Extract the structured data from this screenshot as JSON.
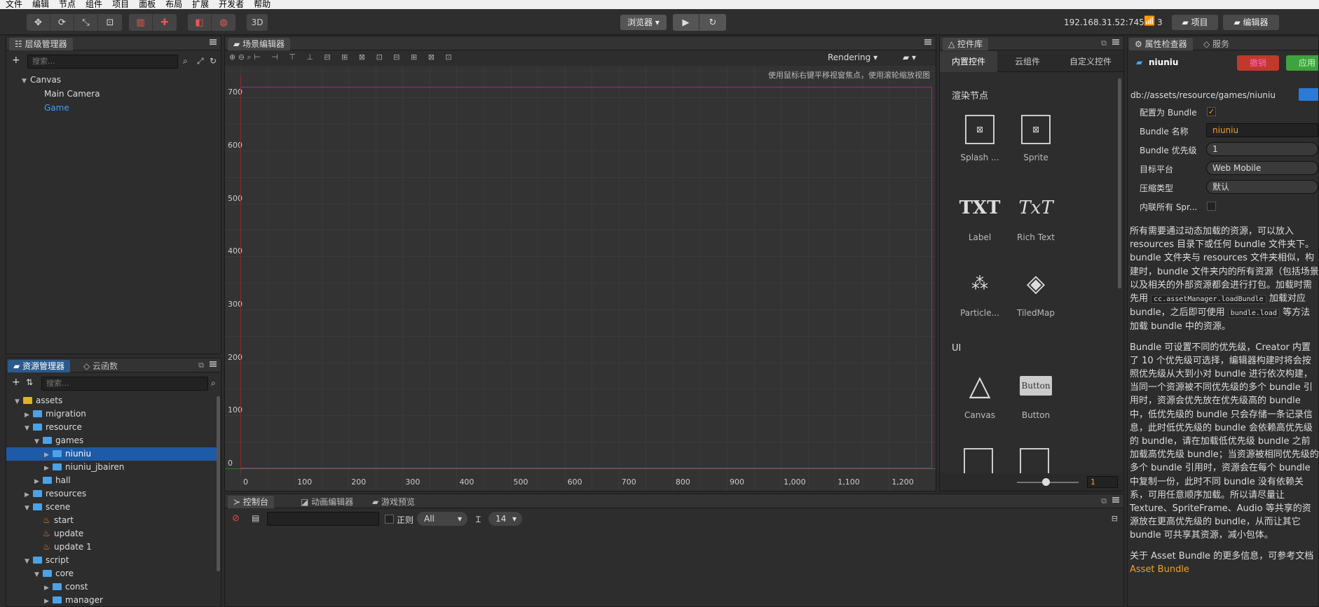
{
  "menu": [
    "文件",
    "编辑",
    "节点",
    "组件",
    "项目",
    "面板",
    "布局",
    "扩展",
    "开发者",
    "帮助"
  ],
  "toolbar": {
    "browser_label": "浏览器 ▾",
    "mode3d": "3D",
    "ip": "192.168.31.52:7456",
    "wifi_count": "3",
    "project_button": "项目",
    "editor_button": "编辑器"
  },
  "hierarchy": {
    "title": "层级管理器",
    "search_placeholder": "搜索...",
    "nodes": [
      "Canvas",
      "Main Camera",
      "Game"
    ]
  },
  "assets": {
    "tab_active": "资源管理器",
    "tab_other": "云函数",
    "search_placeholder": "搜索...",
    "items": [
      {
        "label": "assets",
        "depth": 0,
        "type": "root"
      },
      {
        "label": "migration",
        "depth": 1,
        "type": "folder"
      },
      {
        "label": "resource",
        "depth": 1,
        "type": "folder"
      },
      {
        "label": "games",
        "depth": 2,
        "type": "folder"
      },
      {
        "label": "niuniu",
        "depth": 3,
        "type": "folder",
        "selected": true
      },
      {
        "label": "niuniu_jbairen",
        "depth": 3,
        "type": "folder"
      },
      {
        "label": "hall",
        "depth": 2,
        "type": "folder"
      },
      {
        "label": "resources",
        "depth": 1,
        "type": "folder"
      },
      {
        "label": "scene",
        "depth": 1,
        "type": "folder"
      },
      {
        "label": "start",
        "depth": 2,
        "type": "scene"
      },
      {
        "label": "update",
        "depth": 2,
        "type": "scene"
      },
      {
        "label": "update 1",
        "depth": 2,
        "type": "scene"
      },
      {
        "label": "script",
        "depth": 1,
        "type": "folder"
      },
      {
        "label": "core",
        "depth": 2,
        "type": "folder"
      },
      {
        "label": "const",
        "depth": 3,
        "type": "folder"
      },
      {
        "label": "manager",
        "depth": 3,
        "type": "folder"
      }
    ]
  },
  "scene": {
    "title": "场景编辑器",
    "rendering": "Rendering",
    "hint": "使用鼠标右键平移视窗焦点，使用滚轮缩放视图",
    "y_ticks": [
      "700",
      "600",
      "500",
      "400",
      "300",
      "200",
      "100",
      "0"
    ],
    "x_ticks": [
      "0",
      "100",
      "200",
      "300",
      "400",
      "500",
      "600",
      "700",
      "800",
      "900",
      "1,000",
      "1,100",
      "1,200"
    ]
  },
  "widgets": {
    "title": "控件库",
    "tabs": [
      "内置控件",
      "云组件",
      "自定义控件"
    ],
    "section_render": "渲染节点",
    "section_ui": "UI",
    "items": [
      "Splash ...",
      "Sprite",
      "Label",
      "Rich Text",
      "Particle...",
      "TiledMap",
      "Canvas",
      "Button"
    ],
    "zoom_value": "1",
    "glyph_txt": "TXT",
    "glyph_rich": "TxT",
    "glyph_button": "Button"
  },
  "console": {
    "tabs": [
      "控制台",
      "动画编辑器",
      "游戏预览"
    ],
    "regex_label": "正则",
    "level": "All",
    "font_size": "14"
  },
  "inspector": {
    "tab_active": "属性检查器",
    "tab_other": "服务",
    "name": "niuniu",
    "revert_button": "撤销",
    "apply_button": "应用",
    "path": "db://assets/resource/games/niuniu",
    "props": [
      {
        "label": "配置为 Bundle",
        "value": ""
      },
      {
        "label": "Bundle 名称",
        "value": "niuniu"
      },
      {
        "label": "Bundle 优先级",
        "value": "1"
      },
      {
        "label": "目标平台",
        "value": "Web Mobile"
      },
      {
        "label": "压缩类型",
        "value": "默认"
      },
      {
        "label": "内联所有 Spr...",
        "value": ""
      }
    ],
    "para1_a": "所有需要通过动态加载的资源，可以放入 resources 目录下或任何 bundle 文件夹下。bundle 文件夹与 resources 文件夹相似，构建时，bundle 文件夹内的所有资源（包括场景以及相关的外部资源都会进行打包。加载时需先用",
    "code1": "cc.assetManager.loadBundle",
    "para1_b": "加载对应 bundle，之后即可使用",
    "code2": "bundle.load",
    "para1_c": "等方法加载 bundle 中的资源。",
    "para2": "Bundle 可设置不同的优先级，Creator 内置了 10 个优先级可选择，编辑器构建时将会按照优先级从大到小对 bundle 进行依次构建，当同一个资源被不同优先级的多个 bundle 引用时，资源会优先放在优先级高的 bundle 中，低优先级的 bundle 只会存储一条记录信息，此时低优先级的 bundle 会依赖高优先级的 bundle，请在加载低优先级 bundle 之前加载高优先级 bundle；当资源被相同优先级的多个 bundle 引用时，资源会在每个 bundle 中复制一份，此时不同 bundle 没有依赖关系，可用任意顺序加载。所以请尽量让 Texture、SpriteFrame、Audio 等共享的资源放在更高优先级的 bundle，从而让其它 bundle 可共享其资源，减小包体。",
    "para3": "关于 Asset Bundle 的更多信息，可参考文档",
    "link": "Asset Bundle"
  },
  "colors": {
    "accent": "#2b5a8c",
    "link": "#f0a030",
    "design_rect": "#a020a0",
    "revert": "#c0392b",
    "apply": "#3fa33f"
  }
}
